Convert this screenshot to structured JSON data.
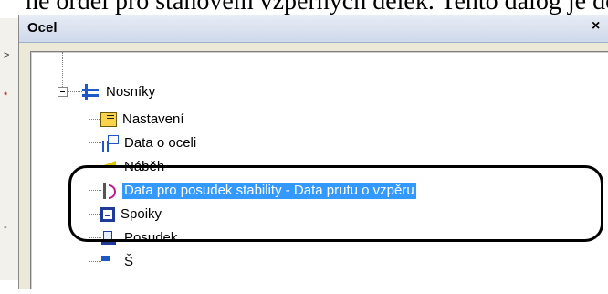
{
  "window": {
    "title": "Ocel",
    "close_glyph": "×"
  },
  "tree": {
    "root": {
      "label": "Nosníky",
      "icon": "beam-group-icon",
      "expanded": true
    },
    "items": [
      {
        "label": "Nastavení",
        "icon": "settings-icon",
        "selected": false
      },
      {
        "label": "Data o oceli",
        "icon": "steel-data-icon",
        "selected": false
      },
      {
        "label": "Náběh",
        "icon": "haunch-icon",
        "selected": false
      },
      {
        "label": "Data pro posudek stability - Data prutu o vzpěru",
        "icon": "stability-data-icon",
        "selected": true
      },
      {
        "label": "Spoiky",
        "icon": "joints-icon",
        "selected": false
      },
      {
        "label": "Posudek",
        "icon": "check-icon",
        "selected": false
      },
      {
        "label": "Š",
        "icon": "partial-item-icon",
        "selected": false
      }
    ]
  },
  "colors": {
    "selection_bg": "#3399ff",
    "selection_text": "#ffffff",
    "panel_bg": "#ffffff",
    "window_bg": "#ece9d8"
  }
}
